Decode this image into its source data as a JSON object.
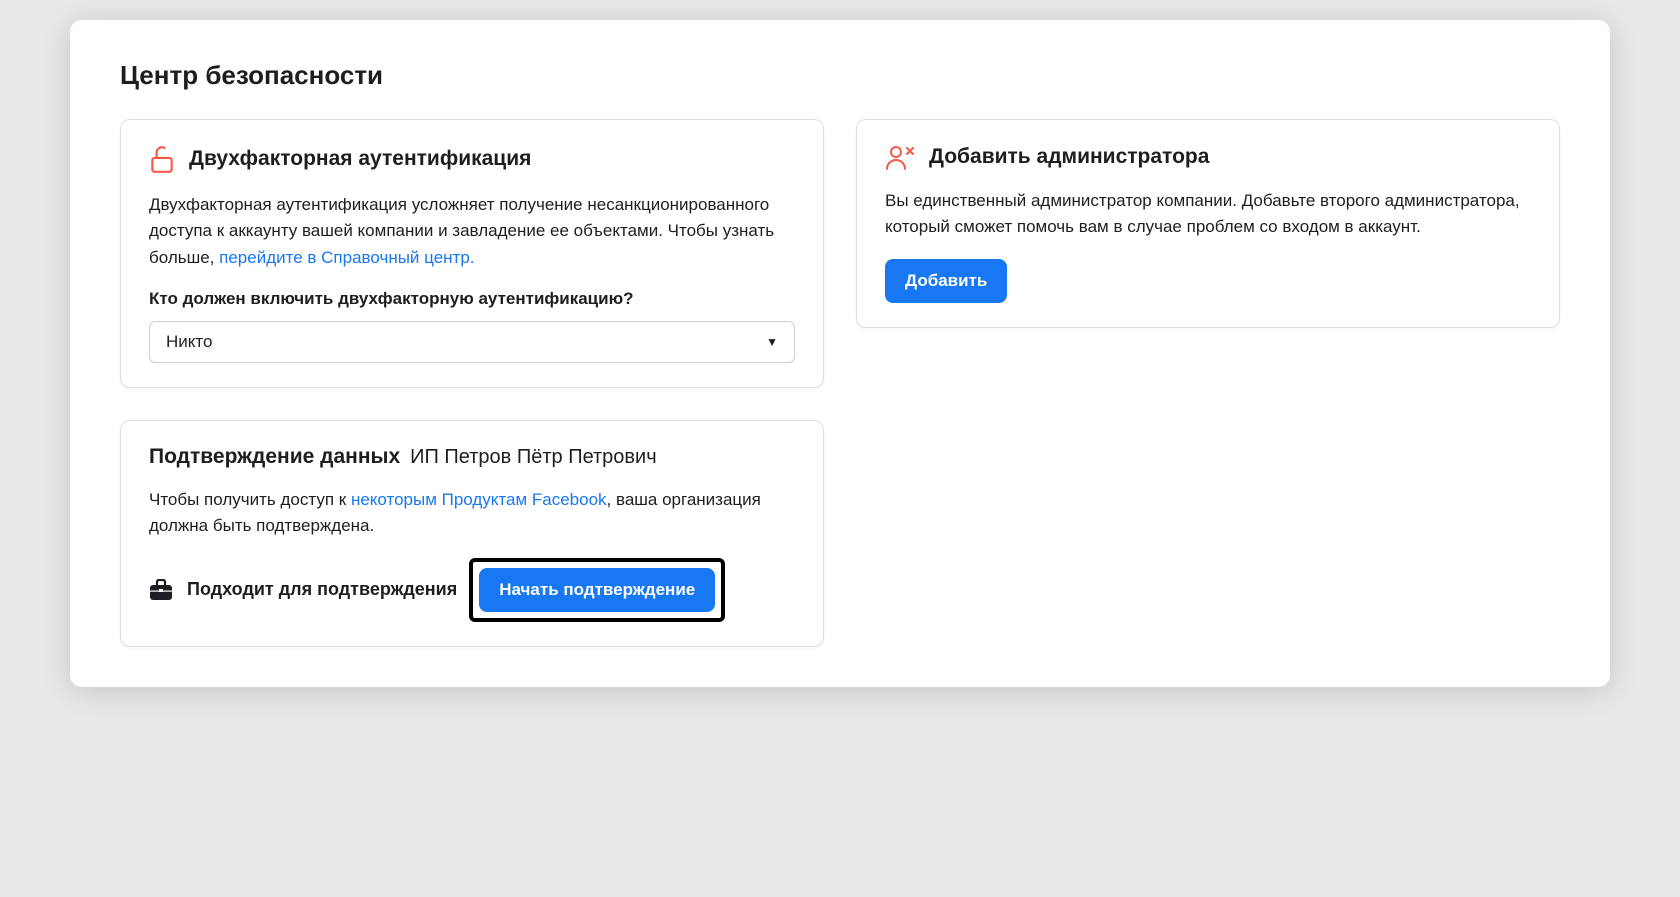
{
  "page_title": "Центр безопасности",
  "two_factor": {
    "title": "Двухфакторная аутентификация",
    "desc_part1": "Двухфакторная аутентификация усложняет получение несанкционированного доступа к аккаунту вашей компании и завладение ее объектами. Чтобы узнать больше, ",
    "desc_link": "перейдите в Справочный центр.",
    "sub_label": "Кто должен включить двухфакторную аутентификацию?",
    "select_value": "Никто"
  },
  "add_admin": {
    "title": "Добавить администратора",
    "desc": "Вы единственный администратор компании. Добавьте второго администратора, который сможет помочь вам в случае проблем со входом в аккаунт.",
    "button_label": "Добавить"
  },
  "verification": {
    "title": "Подтверждение данных",
    "subject": "ИП Петров Пётр Петрович",
    "desc_part1": "Чтобы получить доступ к ",
    "desc_link": "некоторым Продуктам Facebook",
    "desc_part2": ", ваша организация должна быть подтверждена.",
    "status_text": "Подходит для подтверждения",
    "button_label": "Начать подтверждение"
  },
  "colors": {
    "accent": "#1877f2",
    "icon_warn": "#f25b4b"
  }
}
